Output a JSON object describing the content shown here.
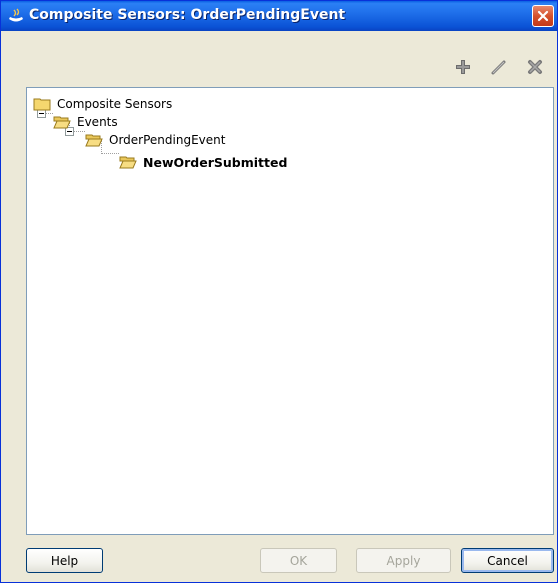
{
  "window": {
    "title": "Composite Sensors: OrderPendingEvent"
  },
  "toolbar": {
    "add_icon": "plus-icon",
    "edit_icon": "pencil-icon",
    "delete_icon": "x-icon"
  },
  "tree": {
    "nodes": [
      {
        "label": "Composite Sensors",
        "level": 0,
        "bold": false
      },
      {
        "label": "Events",
        "level": 1,
        "bold": false
      },
      {
        "label": "OrderPendingEvent",
        "level": 2,
        "bold": false
      },
      {
        "label": "NewOrderSubmitted",
        "level": 3,
        "bold": true
      }
    ]
  },
  "buttons": {
    "help": "Help",
    "ok": "OK",
    "apply": "Apply",
    "cancel": "Cancel"
  },
  "colors": {
    "titlebar": "#0b53d6",
    "close": "#d5512c",
    "folder": "#f5d76e"
  }
}
